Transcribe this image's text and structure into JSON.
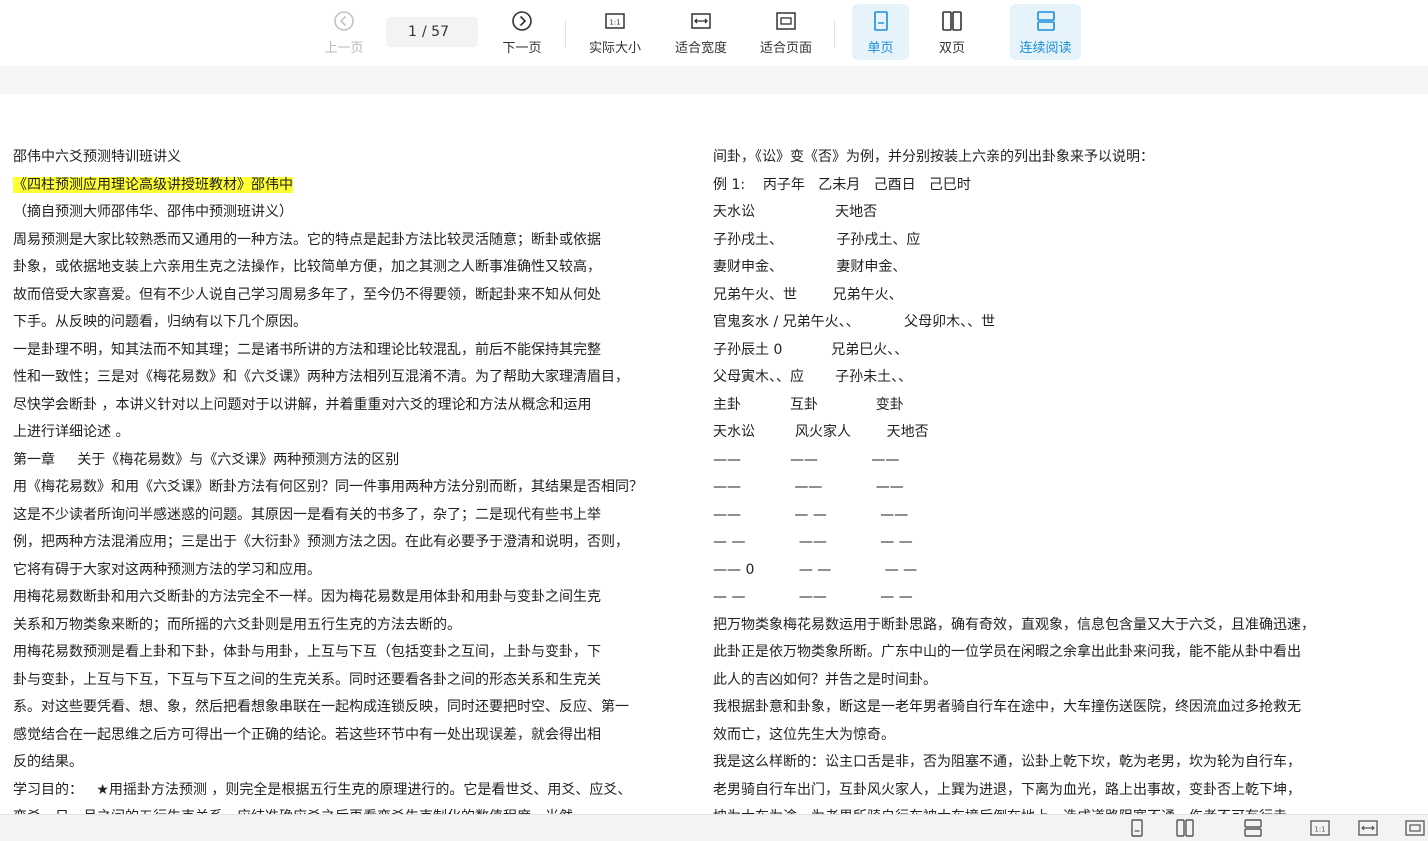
{
  "toolbar": {
    "prev_label": "上一页",
    "page_current": "1",
    "page_total": "/ 57",
    "next_label": "下一页",
    "actual_size_label": "实际大小",
    "actual_size_icon_text": "1:1",
    "fit_width_label": "适合宽度",
    "fit_page_label": "适合页面",
    "single_page_label": "单页",
    "double_page_label": "双页",
    "continuous_label": "连续阅读"
  },
  "bottombar": {
    "actual_size_icon_text": "1:1"
  },
  "colors": {
    "accent": "#1a8ed8",
    "highlight": "#ffff33"
  },
  "document": {
    "left_lines": [
      "邵伟中六爻预测特训班讲义",
      "《四柱预测应用理论高级讲授班教材》邵伟中",
      "（摘自预测大师邵伟华、邵伟中预测班讲义）",
      "周易预测是大家比较熟悉而又通用的一种方法。它的特点是起卦方法比较灵活随意；断卦或依据",
      "卦象，或依据地支装上六亲用生克之法操作，比较简单方便，加之其测之人断事准确性又较高，",
      "故而倍受大家喜爱。但有不少人说自己学习周易多年了，至今仍不得要领，断起卦来不知从何处",
      "下手。从反映的问题看，归纳有以下几个原因。",
      "一是卦理不明，知其法而不知其理；二是诸书所讲的方法和理论比较混乱，前后不能保持其完整",
      "性和一致性；三是对《梅花易数》和《六爻课》两种方法相列互混淆不清。为了帮助大家理清眉目，",
      "尽快学会断卦 ，本讲义针对以上问题对于以讲解，并着重重对六爻的理论和方法从概念和运用",
      "上进行详细论述 。",
      "第一章     关于《梅花易数》与《六爻课》两种预测方法的区别",
      "用《梅花易数》和用《六爻课》断卦方法有何区别？同一件事用两种方法分别而断，其结果是否相同？",
      "这是不少读者所询问半感迷惑的问题。其原因一是看有关的书多了，杂了；二是现代有些书上举",
      "例，把两种方法混淆应用；三是出于《大衍卦》预测方法之因。在此有必要予于澄清和说明，否则，",
      "它将有碍于大家对这两种预测方法的学习和应用。",
      "用梅花易数断卦和用六爻断卦的方法完全不一样。因为梅花易数是用体卦和用卦与变卦之间生克",
      "关系和万物类象来断的；而所摇的六爻卦则是用五行生克的方法去断的。",
      "用梅花易数预测是看上卦和下卦，体卦与用卦，上互与下互（包括变卦之互间，上卦与变卦，下",
      "卦与变卦，上互与下互，下互与下互之间的生克关系。同时还要看各卦之间的形态关系和生克关",
      "系。对这些要凭看、想、象，然后把看想象串联在一起构成连锁反映，同时还要把时空、反应、第一",
      "感觉结合在一起思维之后方可得出一个正确的结论。若这些环节中有一处出现误差，就会得出相",
      "反的结果。",
      "学习目的：   ★用摇卦方法预测 ，则完全是根据五行生克的原理进行的。它是看世爻、用爻、应爻、",
      "变爻、日、月之间的五行生克关系，应结准确应爻之后再看变爻生克制化的数值程度，当然"
    ],
    "right_lines": [
      "间卦，《讼》变《否》为例，并分别按装上六亲的列出卦象来予以说明：",
      "例 1:    丙子年   乙未月   己酉日   己巳时",
      "天水讼                  天地否",
      "子孙戌土、            子孙戌土、应",
      "妻财申金、            妻财申金、",
      "兄弟午火、世        兄弟午火、",
      "官鬼亥水 / 兄弟午火、、          父母卯木、、世",
      "子孙辰土 0           兄弟巳火、、",
      "父母寅木、、应       子孙未土、、",
      "主卦           互卦             变卦",
      "天水讼         风火家人        天地否",
      "——           ——            ——",
      "——            ——            ——",
      "——            — —            ——",
      "— —            ——            — —",
      "—— 0          — —            — —",
      "— —            ——            — —",
      "把万物类象梅花易数运用于断卦思路，确有奇效，直观象，信息包含量又大于六爻，且准确迅速，",
      "此卦正是依万物类象所断。广东中山的一位学员在闲暇之余拿出此卦来问我，能不能从卦中看出",
      "此人的吉凶如何？并告之是时间卦。",
      "我根据卦意和卦象，断这是一老年男者骑自行车在途中，大车撞伤送医院，终因流血过多抢救无",
      "效而亡，这位先生大为惊奇。",
      "我是这么样断的：讼主口舌是非，否为阻塞不通，讼卦上乾下坎，乾为老男，坎为轮为自行车，",
      "老男骑自行车出门，互卦风火家人，上巽为进退，下离为血光，路上出事故，变卦否上乾下坤，",
      "坤为大车为途，为老男所骑自行车被大车撞后倒在地上，造成道路阻塞不通，伤者不可有行走"
    ]
  }
}
